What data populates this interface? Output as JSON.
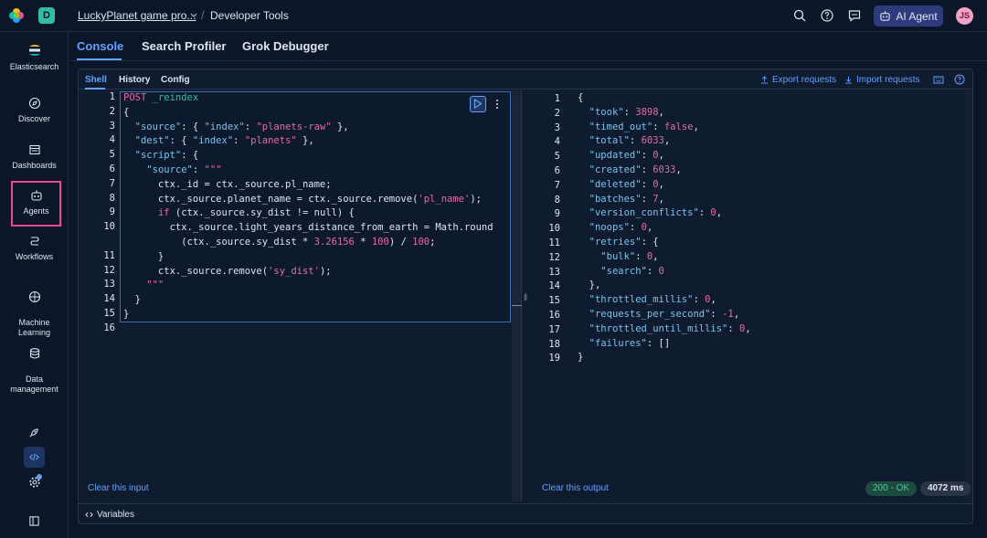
{
  "topbar": {
    "space_letter": "D",
    "breadcrumb_project": "LuckyPlanet game pro...",
    "breadcrumb_separator": "/",
    "breadcrumb_page": "Developer Tools",
    "ai_agent_label": "AI Agent",
    "avatar_initials": "JS"
  },
  "sidenav": {
    "items": [
      {
        "label": "Elasticsearch",
        "icon": "elasticsearch-logo-icon"
      },
      {
        "label": "Discover",
        "icon": "compass-icon"
      },
      {
        "label": "Dashboards",
        "icon": "dashboard-icon"
      },
      {
        "label": "Agents",
        "icon": "robot-icon"
      },
      {
        "label": "Workflows",
        "icon": "workflow-icon"
      },
      {
        "label": "Machine\nLearning",
        "icon": "machine-learning-icon"
      },
      {
        "label": "Data\nmanagement",
        "icon": "database-icon"
      }
    ]
  },
  "main_tabs": [
    "Console",
    "Search Profiler",
    "Grok Debugger"
  ],
  "sub_tabs": [
    "Shell",
    "History",
    "Config"
  ],
  "actions": {
    "export": "Export requests",
    "import": "Import requests"
  },
  "editor": {
    "line_numbers": [
      "1",
      "2",
      "3",
      "4",
      "5",
      "6",
      "7",
      "8",
      "9",
      "10",
      "",
      "11",
      "12",
      "13",
      "14",
      "15",
      "16"
    ],
    "clear_label": "Clear this input"
  },
  "output": {
    "line_numbers": [
      "1",
      "2",
      "3",
      "4",
      "5",
      "6",
      "7",
      "8",
      "9",
      "10",
      "11",
      "12",
      "13",
      "14",
      "15",
      "16",
      "17",
      "18",
      "19"
    ],
    "clear_label": "Clear this output",
    "status": "200 - OK",
    "duration": "4072 ms"
  },
  "variables_label": "Variables",
  "colors": {
    "accent": "#61a2ff",
    "highlight_border": "#e9479a",
    "status_ok": "#3fd0a3"
  }
}
